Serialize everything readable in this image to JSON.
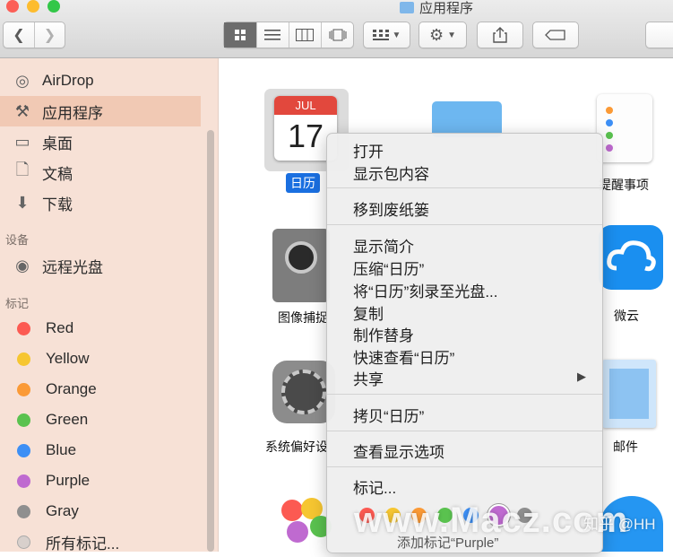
{
  "window": {
    "title": "应用程序"
  },
  "traffic_lights": {
    "close": "#fc5f57",
    "minimize": "#fdbc2e",
    "zoom": "#33c748"
  },
  "toolbar": {
    "back_icon": "chevron-left-icon",
    "forward_icon": "chevron-right-icon",
    "views": [
      "icon-view",
      "list-view",
      "column-view",
      "cover-flow-view"
    ],
    "active_view": "icon-view"
  },
  "sidebar": {
    "favorites": [
      {
        "label": "AirDrop",
        "icon": "airdrop-icon"
      },
      {
        "label": "应用程序",
        "icon": "applications-icon",
        "selected": true
      },
      {
        "label": "桌面",
        "icon": "desktop-icon"
      },
      {
        "label": "文稿",
        "icon": "documents-icon"
      },
      {
        "label": "下载",
        "icon": "downloads-icon"
      }
    ],
    "devices_header": "设备",
    "devices": [
      {
        "label": "远程光盘",
        "icon": "disc-icon"
      }
    ],
    "tags_header": "标记",
    "tags": [
      {
        "label": "Red",
        "color": "#fc5a52"
      },
      {
        "label": "Yellow",
        "color": "#f6c631"
      },
      {
        "label": "Orange",
        "color": "#fb9a36"
      },
      {
        "label": "Green",
        "color": "#5ac24f"
      },
      {
        "label": "Blue",
        "color": "#3d8ff5"
      },
      {
        "label": "Purple",
        "color": "#bf6ad0"
      },
      {
        "label": "Gray",
        "color": "#8f8f8f"
      }
    ],
    "all_tags": "所有标记..."
  },
  "apps": {
    "calendar": {
      "label": "日历",
      "month": "JUL",
      "day": "17"
    },
    "image_capture": "图像捕捉",
    "system_prefs": "系统偏好设",
    "reminders": "提醒事项",
    "weiyun": "微云",
    "mail": "邮件"
  },
  "context_menu": {
    "items": [
      {
        "label": "打开"
      },
      {
        "label": "显示包内容"
      },
      {
        "label": "移到废纸篓"
      },
      {
        "label": "显示简介"
      },
      {
        "label": "压缩“日历”"
      },
      {
        "label": "将“日历”刻录至光盘..."
      },
      {
        "label": "复制"
      },
      {
        "label": "制作替身"
      },
      {
        "label": "快速查看“日历”"
      },
      {
        "label": "共享",
        "has_submenu": true
      },
      {
        "label": "拷贝“日历”"
      },
      {
        "label": "查看显示选项"
      },
      {
        "label": "标记..."
      }
    ],
    "submenu_arrow": "▶",
    "tag_colors": [
      "#fc5a52",
      "#f6c631",
      "#fb9a36",
      "#5ac24f",
      "#3d8ff5",
      "#bf6ad0",
      "#8f8f8f"
    ],
    "add_tags_label": "添加标记“Purple”"
  },
  "watermark": {
    "left": "www.Macz.com",
    "right": "知乎 @HH"
  }
}
